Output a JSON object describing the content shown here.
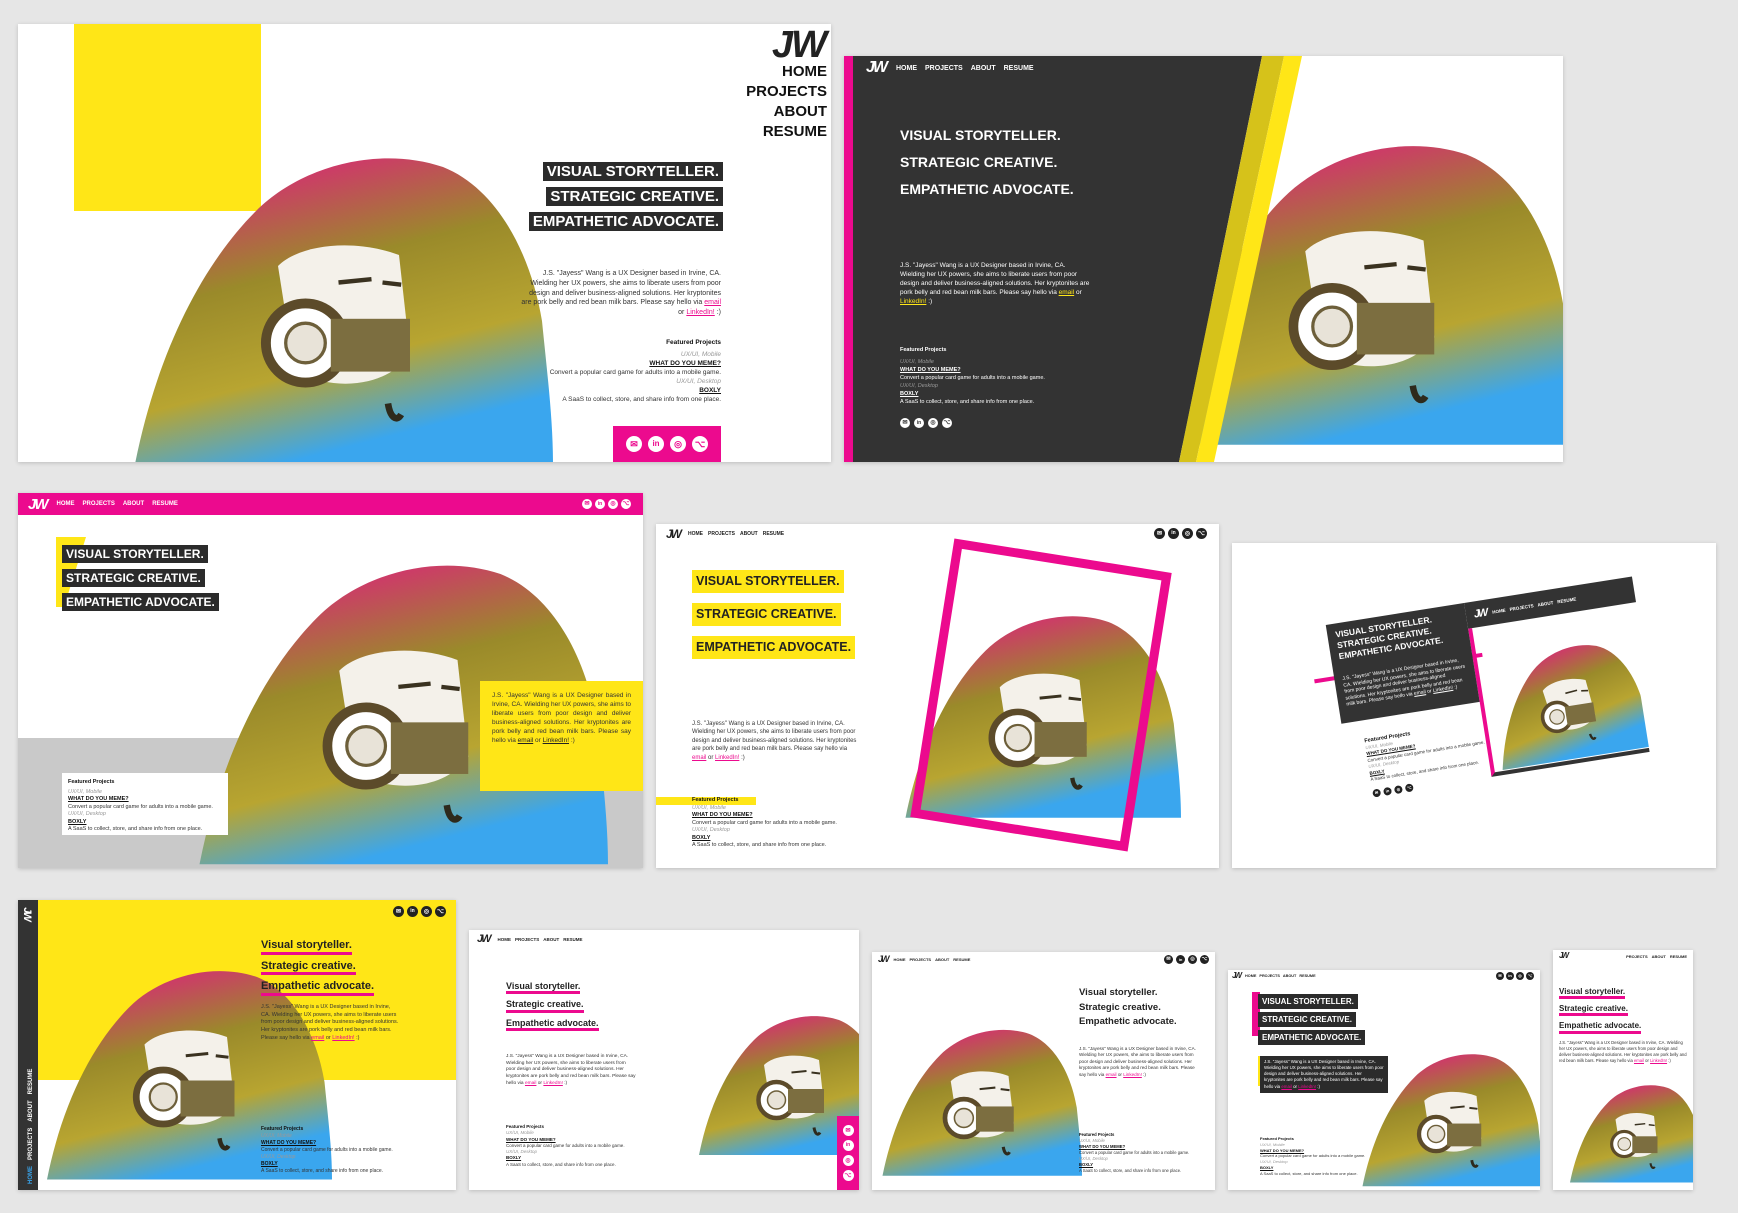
{
  "brand": {
    "logo": "JW",
    "accent": "#ec0a8e",
    "yellow": "#ffe617",
    "dark": "#333333"
  },
  "nav": {
    "home": "HOME",
    "projects": "PROJECTS",
    "about": "ABOUT",
    "resume": "RESUME"
  },
  "headline": {
    "line1": "VISUAL STORYTELLER.",
    "line2": "STRATEGIC CREATIVE.",
    "line3": "EMPATHETIC ADVOCATE.",
    "line1_lc": "Visual storyteller.",
    "line2_lc": "Strategic creative.",
    "line3_lc": "Empathetic advocate."
  },
  "bio": {
    "text": "J.S. \"Jayess\" Wang is a UX Designer based in Irvine, CA. Wielding her UX powers, she aims to liberate users from poor design and deliver business-aligned solutions. Her kryptonites are pork belly and red bean milk bars. Please say hello via",
    "email": "email",
    "or": "or",
    "linkedin": "LinkedIn!",
    "smile": ":)"
  },
  "featured": {
    "title": "Featured Projects",
    "p1_cat": "UX/UI, Mobile",
    "p1_name": "WHAT DO YOU MEME?",
    "p1_desc": "Convert a popular card game for adults into a mobile game.",
    "p2_cat": "UX/UI, Desktop",
    "p2_name": "BOXLY",
    "p2_desc": "A SaaS to collect, store, and share info from one place."
  },
  "icons": {
    "email": "email-icon",
    "linkedin": "linkedin-icon",
    "instagram": "instagram-icon",
    "github": "github-icon"
  },
  "glyphs": {
    "email": "✉",
    "linkedin": "in",
    "instagram": "◎",
    "github": "⌥"
  }
}
